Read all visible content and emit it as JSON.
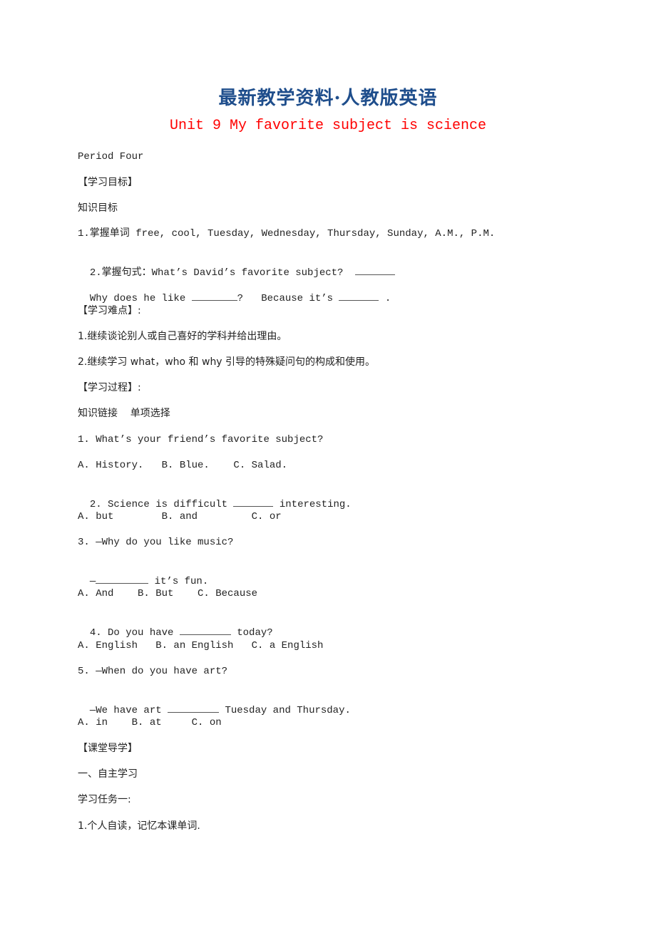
{
  "header": {
    "title": "最新教学资料·人教版英语",
    "subtitle": "Unit 9 My favorite subject is science"
  },
  "colors": {
    "title": "#1f4e8c",
    "subtitle": "#ff0000"
  },
  "body": {
    "period": "Period Four",
    "objectives_heading": "【学习目标】",
    "knowledge_goal": "知识目标",
    "goal1": "1.掌握单词 free, cool, Tuesday, Wednesday, Thursday, Sunday, A.M., P.M.",
    "goal2_prefix": "2.掌握句式：What’s David’s favorite subject?",
    "goal2b_a": "Why does he like",
    "goal2b_b": "?   Because it’s",
    "goal2b_c": ".",
    "difficulty_heading": "【学习难点】:",
    "difficulty1": "1.继续谈论别人或自己喜好的学科并给出理由。",
    "difficulty2": "2.继续学习 what，who 和 why 引导的特殊疑问句的构成和使用。",
    "process_heading": "【学习过程】:",
    "link_heading": "知识链接    单项选择",
    "questions": [
      {
        "stem": "1. What’s your friend’s favorite subject?",
        "options": "A. History.   B. Blue.    C. Salad."
      },
      {
        "stem_a": "2. Science is difficult",
        "stem_b": "interesting.",
        "options": "A. but        B. and         C. or"
      },
      {
        "stem": "3. —Why do you like music?",
        "answer_a": "—",
        "answer_b": "it’s fun.",
        "options": "A. And    B. But    C. Because"
      },
      {
        "stem_a": "4. Do you have",
        "stem_b": "today?",
        "options": "A. English   B. an English   C. a English"
      },
      {
        "stem": "5. —When do you have art?",
        "answer_a": "—We have art",
        "answer_b": "Tuesday and Thursday.",
        "options": "A. in    B. at     C. on"
      }
    ],
    "class_heading": "【课堂导学】",
    "self_study": "一、自主学习",
    "task1": "学习任务一:",
    "task1_item1": "1.个人自读，记忆本课单词."
  }
}
